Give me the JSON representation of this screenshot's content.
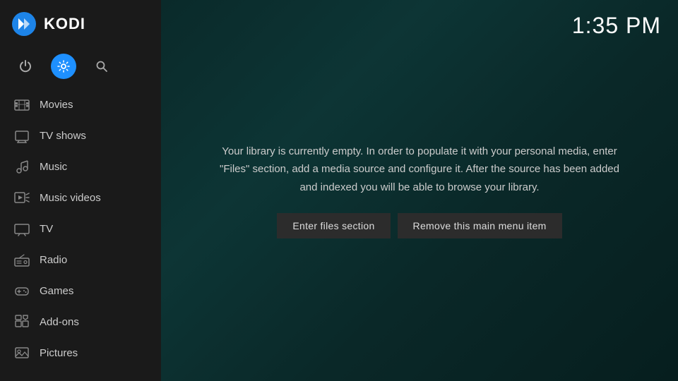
{
  "app": {
    "name": "KODI",
    "time": "1:35 PM"
  },
  "sidebar": {
    "icons": [
      {
        "name": "power-icon",
        "label": "Power",
        "active": false
      },
      {
        "name": "settings-icon",
        "label": "Settings",
        "active": true
      },
      {
        "name": "search-icon",
        "label": "Search",
        "active": false
      }
    ],
    "nav_items": [
      {
        "label": "Movies",
        "icon": "movies-icon"
      },
      {
        "label": "TV shows",
        "icon": "tv-shows-icon"
      },
      {
        "label": "Music",
        "icon": "music-icon"
      },
      {
        "label": "Music videos",
        "icon": "music-videos-icon"
      },
      {
        "label": "TV",
        "icon": "tv-icon"
      },
      {
        "label": "Radio",
        "icon": "radio-icon"
      },
      {
        "label": "Games",
        "icon": "games-icon"
      },
      {
        "label": "Add-ons",
        "icon": "addons-icon"
      },
      {
        "label": "Pictures",
        "icon": "pictures-icon"
      }
    ]
  },
  "main": {
    "library_message": "Your library is currently empty. In order to populate it with your personal media, enter \"Files\" section, add a media source and configure it. After the source has been added and indexed you will be able to browse your library.",
    "button_enter_files": "Enter files section",
    "button_remove_menu": "Remove this main menu item"
  }
}
